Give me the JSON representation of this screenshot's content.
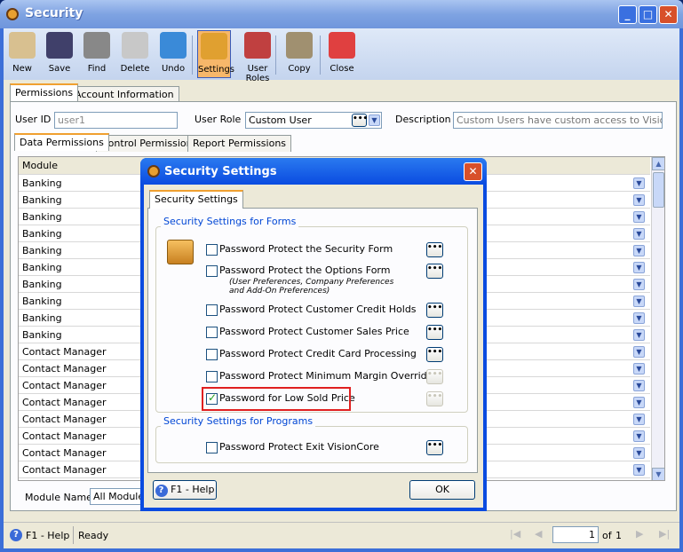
{
  "window": {
    "title": "Security"
  },
  "toolbar": [
    {
      "label": "New",
      "icon": "new-user-icon"
    },
    {
      "label": "Save",
      "icon": "floppy-icon"
    },
    {
      "label": "Find",
      "icon": "find-icon"
    },
    {
      "label": "Delete",
      "icon": "trash-icon"
    },
    {
      "label": "Undo",
      "icon": "undo-icon"
    },
    {
      "label": "Settings",
      "icon": "lock-settings-icon",
      "active": true
    },
    {
      "label": "User Roles",
      "icon": "users-icon"
    },
    {
      "label": "Copy",
      "icon": "copy-icon"
    },
    {
      "label": "Close",
      "icon": "close-form-icon"
    }
  ],
  "main_tabs": [
    "Permissions",
    "Account Information"
  ],
  "form": {
    "user_id_label": "User ID",
    "user_id": "user1",
    "user_role_label": "User Role",
    "user_role": "Custom User",
    "description_label": "Description",
    "description": "Custom Users have custom access to Visioncore"
  },
  "sub_tabs": [
    "Data Permissions",
    "Control Permissions",
    "Report Permissions"
  ],
  "grid": {
    "header": "Module",
    "rows": [
      "Banking",
      "Banking",
      "Banking",
      "Banking",
      "Banking",
      "Banking",
      "Banking",
      "Banking",
      "Banking",
      "Banking",
      "Contact Manager",
      "Contact Manager",
      "Contact Manager",
      "Contact Manager",
      "Contact Manager",
      "Contact Manager",
      "Contact Manager",
      "Contact Manager"
    ]
  },
  "module_filter": {
    "label": "Module Name",
    "value": "All Modules"
  },
  "status": {
    "help": "F1 - Help",
    "text": "Ready",
    "page": "1",
    "of": "of",
    "total": "1"
  },
  "dialog": {
    "title": "Security Settings",
    "tab": "Security Settings",
    "forms_group": "Security Settings for Forms",
    "forms_options": [
      {
        "label": "Password Protect the Security Form",
        "checked": false,
        "enabled": true
      },
      {
        "label": "Password Protect the Options Form",
        "note": "(User Preferences, Company Preferences and Add-On Preferences)",
        "checked": false,
        "enabled": true
      },
      {
        "label": "Password Protect Customer Credit Holds",
        "checked": false,
        "enabled": true
      },
      {
        "label": "Password Protect Customer Sales Price",
        "checked": false,
        "enabled": true
      },
      {
        "label": "Password Protect Credit Card Processing",
        "checked": false,
        "enabled": true
      },
      {
        "label": "Password Protect Minimum Margin Override",
        "checked": false,
        "enabled": false
      },
      {
        "label": "Password for Low Sold Price",
        "checked": true,
        "enabled": false,
        "highlighted": true
      }
    ],
    "programs_group": "Security Settings for Programs",
    "programs_options": [
      {
        "label": "Password Protect Exit VisionCore",
        "checked": false,
        "enabled": true
      }
    ],
    "help_button": "F1 - Help",
    "ok_button": "OK",
    "ellipsis": "•••"
  },
  "colors": {
    "highlight": "#e02020",
    "title_blue": "#0a4be0",
    "active_tool": "#f7b76a"
  }
}
